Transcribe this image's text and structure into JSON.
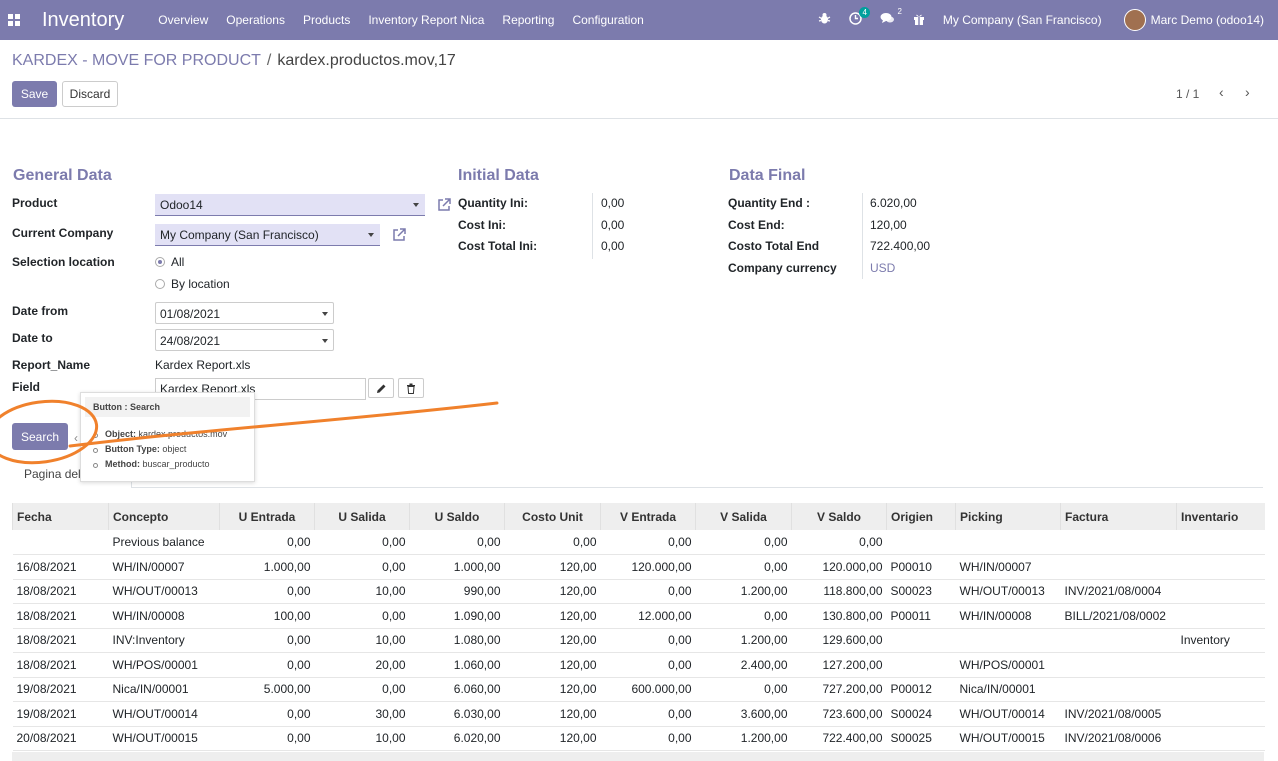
{
  "navbar": {
    "app_name": "Inventory",
    "menu": [
      "Overview",
      "Operations",
      "Products",
      "Inventory Report Nica",
      "Reporting",
      "Configuration"
    ],
    "activity_badge": "4",
    "messages_badge": "2",
    "company": "My Company (San Francisco)",
    "user": "Marc Demo (odoo14)"
  },
  "breadcrumb": {
    "parent": "KARDEX - MOVE FOR PRODUCT",
    "separator": "/",
    "current": "kardex.productos.mov,17"
  },
  "buttons": {
    "save": "Save",
    "discard": "Discard",
    "search": "Search"
  },
  "pager": {
    "value": "1 / 1",
    "prev": "‹",
    "next": "›"
  },
  "general": {
    "title": "General Data",
    "product_label": "Product",
    "product_value": "Odoo14",
    "company_label": "Current Company",
    "company_value": "My Company (San Francisco)",
    "location_label": "Selection location",
    "location_all": "All",
    "location_by": "By location",
    "date_from_label": "Date from",
    "date_from_value": "01/08/2021",
    "date_to_label": "Date to",
    "date_to_value": "24/08/2021",
    "report_name_label": "Report_Name",
    "report_name_value": "Kardex Report.xls",
    "field_label": "Field",
    "field_value": "Kardex Report.xls"
  },
  "initial": {
    "title": "Initial Data",
    "rows": [
      {
        "label": "Quantity Ini:",
        "value": "0,00"
      },
      {
        "label": "Cost Ini:",
        "value": "0,00"
      },
      {
        "label": "Cost Total Ini:",
        "value": "0,00"
      }
    ]
  },
  "final": {
    "title": "Data Final",
    "rows": [
      {
        "label": "Quantity End :",
        "value": "6.020,00"
      },
      {
        "label": "Cost End:",
        "value": "120,00"
      },
      {
        "label": "Costo Total End",
        "value": "722.400,00"
      },
      {
        "label": "Company currency",
        "value": "USD"
      }
    ]
  },
  "tooltip": {
    "title": "Button : Search",
    "items": [
      {
        "key": "Object:",
        "value": "kardex.productos.mov"
      },
      {
        "key": "Button Type:",
        "value": "object"
      },
      {
        "key": "Method:",
        "value": "buscar_producto"
      }
    ]
  },
  "tab": {
    "label": "Pagina del"
  },
  "table": {
    "headers": [
      "Fecha",
      "Concepto",
      "U Entrada",
      "U Salida",
      "U Saldo",
      "Costo Unit",
      "V Entrada",
      "V Salida",
      "V Saldo",
      "Origien",
      "Picking",
      "Factura",
      "Inventario"
    ],
    "rows": [
      [
        "",
        "Previous balance",
        "0,00",
        "0,00",
        "0,00",
        "0,00",
        "0,00",
        "0,00",
        "0,00",
        "",
        "",
        "",
        ""
      ],
      [
        "16/08/2021",
        "WH/IN/00007",
        "1.000,00",
        "0,00",
        "1.000,00",
        "120,00",
        "120.000,00",
        "0,00",
        "120.000,00",
        "P00010",
        "WH/IN/00007",
        "",
        ""
      ],
      [
        "18/08/2021",
        "WH/OUT/00013",
        "0,00",
        "10,00",
        "990,00",
        "120,00",
        "0,00",
        "1.200,00",
        "118.800,00",
        "S00023",
        "WH/OUT/00013",
        "INV/2021/08/0004",
        ""
      ],
      [
        "18/08/2021",
        "WH/IN/00008",
        "100,00",
        "0,00",
        "1.090,00",
        "120,00",
        "12.000,00",
        "0,00",
        "130.800,00",
        "P00011",
        "WH/IN/00008",
        "BILL/2021/08/0002",
        ""
      ],
      [
        "18/08/2021",
        "INV:Inventory",
        "0,00",
        "10,00",
        "1.080,00",
        "120,00",
        "0,00",
        "1.200,00",
        "129.600,00",
        "",
        "",
        "",
        "Inventory"
      ],
      [
        "18/08/2021",
        "WH/POS/00001",
        "0,00",
        "20,00",
        "1.060,00",
        "120,00",
        "0,00",
        "2.400,00",
        "127.200,00",
        "",
        "WH/POS/00001",
        "",
        ""
      ],
      [
        "19/08/2021",
        "Nica/IN/00001",
        "5.000,00",
        "0,00",
        "6.060,00",
        "120,00",
        "600.000,00",
        "0,00",
        "727.200,00",
        "P00012",
        "Nica/IN/00001",
        "",
        ""
      ],
      [
        "19/08/2021",
        "WH/OUT/00014",
        "0,00",
        "30,00",
        "6.030,00",
        "120,00",
        "0,00",
        "3.600,00",
        "723.600,00",
        "S00024",
        "WH/OUT/00014",
        "INV/2021/08/0005",
        ""
      ],
      [
        "20/08/2021",
        "WH/OUT/00015",
        "0,00",
        "10,00",
        "6.020,00",
        "120,00",
        "0,00",
        "1.200,00",
        "722.400,00",
        "S00025",
        "WH/OUT/00015",
        "INV/2021/08/0006",
        ""
      ]
    ]
  },
  "colors": {
    "primary": "#7c7bad",
    "badge": "#00a09d",
    "annotation": "#f0812c",
    "link": "#7c7bad"
  }
}
